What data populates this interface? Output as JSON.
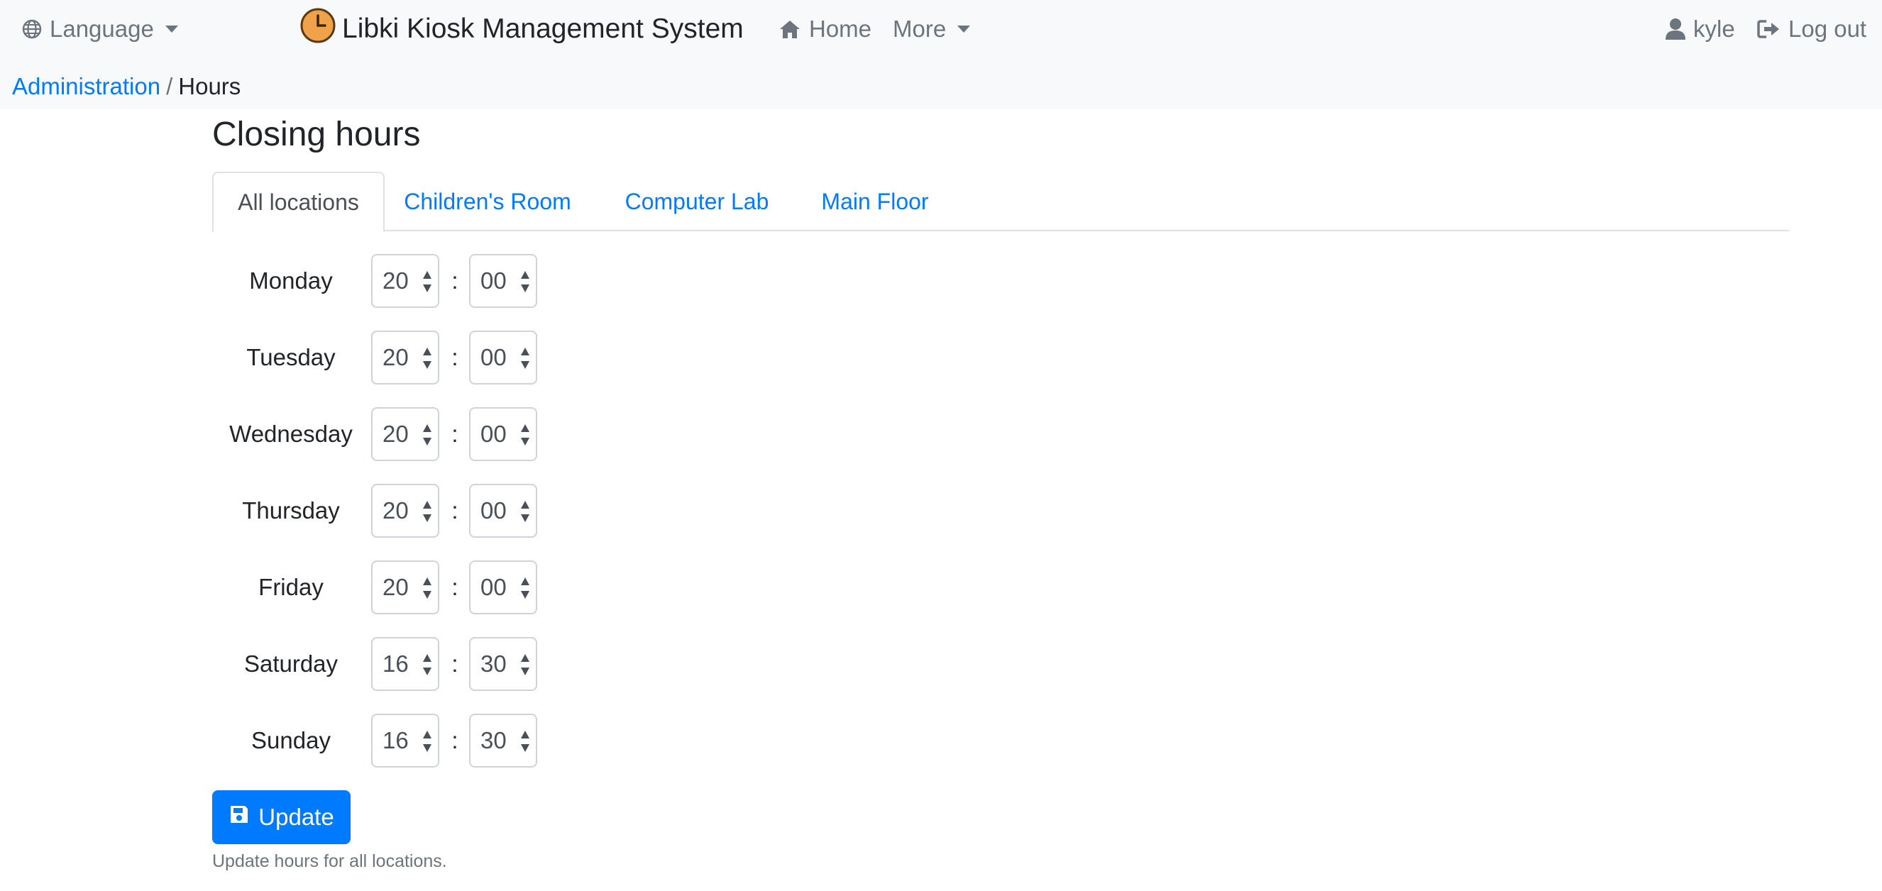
{
  "navbar": {
    "language_label": "Language",
    "brand": "Libki Kiosk Management System",
    "home_label": "Home",
    "more_label": "More",
    "user_label": "kyle",
    "logout_label": "Log out"
  },
  "breadcrumb": {
    "parent": "Administration",
    "separator": "/",
    "current": "Hours"
  },
  "page": {
    "title": "Closing hours",
    "tabs": [
      {
        "label": "All locations",
        "active": true
      },
      {
        "label": "Children's Room",
        "active": false
      },
      {
        "label": "Computer Lab",
        "active": false
      },
      {
        "label": "Main Floor",
        "active": false
      }
    ],
    "separator": ":",
    "days": [
      {
        "day": "Monday",
        "hour": "20",
        "minute": "00"
      },
      {
        "day": "Tuesday",
        "hour": "20",
        "minute": "00"
      },
      {
        "day": "Wednesday",
        "hour": "20",
        "minute": "00"
      },
      {
        "day": "Thursday",
        "hour": "20",
        "minute": "00"
      },
      {
        "day": "Friday",
        "hour": "20",
        "minute": "00"
      },
      {
        "day": "Saturday",
        "hour": "16",
        "minute": "30"
      },
      {
        "day": "Sunday",
        "hour": "16",
        "minute": "30"
      }
    ],
    "update_label": "Update",
    "help_text": "Update hours for all locations."
  },
  "icons": {
    "language": "globe-icon",
    "brand": "clock-icon",
    "home": "home-icon",
    "user": "user-icon",
    "logout": "sign-out-icon",
    "update": "save-icon"
  },
  "colors": {
    "link": "#007bff",
    "primary_button": "#007bff",
    "navbar_bg": "#f8f9fa",
    "brand_clock": "#f0a24a"
  }
}
